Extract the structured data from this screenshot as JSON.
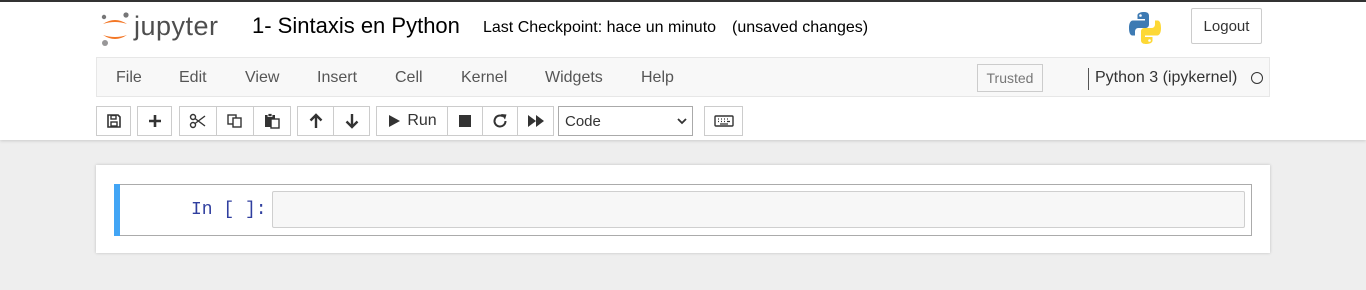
{
  "header": {
    "logo_text": "jupyter",
    "notebook_title": "1- Sintaxis en Python",
    "checkpoint": "Last Checkpoint: hace un minuto",
    "unsaved": "(unsaved changes)",
    "logout_label": "Logout"
  },
  "menu": {
    "items": [
      "File",
      "Edit",
      "View",
      "Insert",
      "Cell",
      "Kernel",
      "Widgets",
      "Help"
    ],
    "trusted_label": "Trusted",
    "kernel_name": "Python 3 (ipykernel)",
    "kernel_status": "idle"
  },
  "toolbar": {
    "run_label": "Run",
    "cell_type": "Code",
    "icons": [
      "save-icon",
      "plus-icon",
      "cut-icon",
      "copy-icon",
      "paste-icon",
      "arrow-up-icon",
      "arrow-down-icon",
      "play-icon",
      "stop-icon",
      "restart-icon",
      "fast-forward-icon",
      "keyboard-icon"
    ]
  },
  "cell": {
    "prompt": "In [ ]:",
    "content": ""
  },
  "colors": {
    "cell_active_bar": "#42a5f5",
    "prompt_color": "#303f9f",
    "logo_orange": "#f37726"
  }
}
